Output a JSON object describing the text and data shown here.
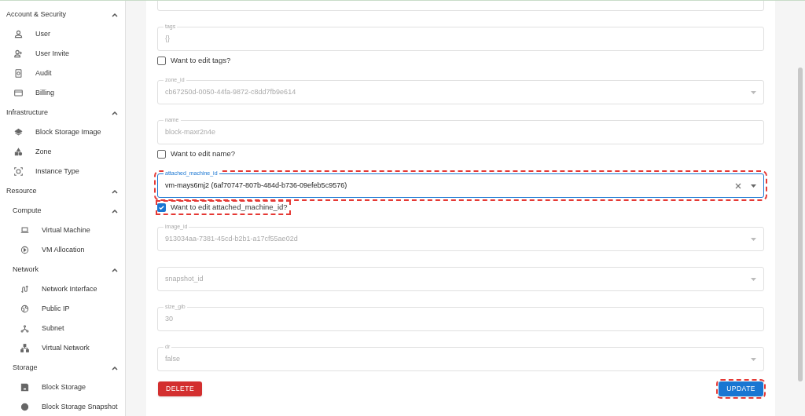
{
  "sidebar": {
    "sections": [
      {
        "label": "Account & Security",
        "expanded": true,
        "children": [
          {
            "label": "User"
          },
          {
            "label": "User Invite"
          },
          {
            "label": "Audit"
          },
          {
            "label": "Billing"
          }
        ]
      },
      {
        "label": "Infrastructure",
        "expanded": true,
        "children": [
          {
            "label": "Block Storage Image"
          },
          {
            "label": "Zone"
          },
          {
            "label": "Instance Type"
          }
        ]
      },
      {
        "label": "Resource",
        "expanded": true,
        "children": [
          {
            "label": "Compute",
            "expanded": true,
            "children": [
              {
                "label": "Virtual Machine"
              },
              {
                "label": "VM Allocation"
              }
            ]
          },
          {
            "label": "Network",
            "expanded": true,
            "children": [
              {
                "label": "Network Interface"
              },
              {
                "label": "Public IP"
              },
              {
                "label": "Subnet"
              },
              {
                "label": "Virtual Network"
              }
            ]
          },
          {
            "label": "Storage",
            "expanded": true,
            "children": [
              {
                "label": "Block Storage"
              },
              {
                "label": "Block Storage Snapshot"
              }
            ]
          }
        ]
      }
    ]
  },
  "form": {
    "items": [
      {
        "kind": "text",
        "disabled": true,
        "highlighted": false
      },
      {
        "kind": "text",
        "label": "tags",
        "value": "{}",
        "disabled": true,
        "highlighted": false
      },
      {
        "kind": "checkbox",
        "label": "Want to edit tags?",
        "checked": false,
        "highlighted": false
      },
      {
        "kind": "select",
        "label": "zone_id",
        "value": "cb67250d-0050-44fa-9872-c8dd7fb9e614",
        "disabled": true,
        "highlighted": false
      },
      {
        "kind": "text",
        "label": "name",
        "value": "block-maxr2n4e",
        "disabled": true,
        "highlighted": false
      },
      {
        "kind": "checkbox",
        "label": "Want to edit name?",
        "checked": false,
        "highlighted": false
      },
      {
        "kind": "select",
        "label": "attached_machine_id",
        "value": "vm-mays6mj2 (6af70747-807b-484d-b736-09efeb5c9576)",
        "disabled": false,
        "focused": true,
        "clearable": true,
        "highlighted": true
      },
      {
        "kind": "checkbox",
        "label": "Want to edit attached_machine_id?",
        "checked": true,
        "highlighted": true
      },
      {
        "kind": "select",
        "label": "image_id",
        "value": "913034aa-7381-45cd-b2b1-a17cf55ae02d",
        "disabled": true,
        "highlighted": false
      },
      {
        "kind": "select",
        "placeholder": "snapshot_id",
        "disabled": true,
        "highlighted": false
      },
      {
        "kind": "text",
        "label": "size_gib",
        "value": "30",
        "disabled": true,
        "highlighted": false
      },
      {
        "kind": "select",
        "label": "dr",
        "value": "false",
        "disabled": true,
        "highlighted": false
      }
    ],
    "buttons": [
      {
        "label": "DELETE",
        "kind": "danger",
        "highlighted": false
      },
      {
        "label": "UPDATE",
        "kind": "primary",
        "highlighted": true
      }
    ]
  }
}
